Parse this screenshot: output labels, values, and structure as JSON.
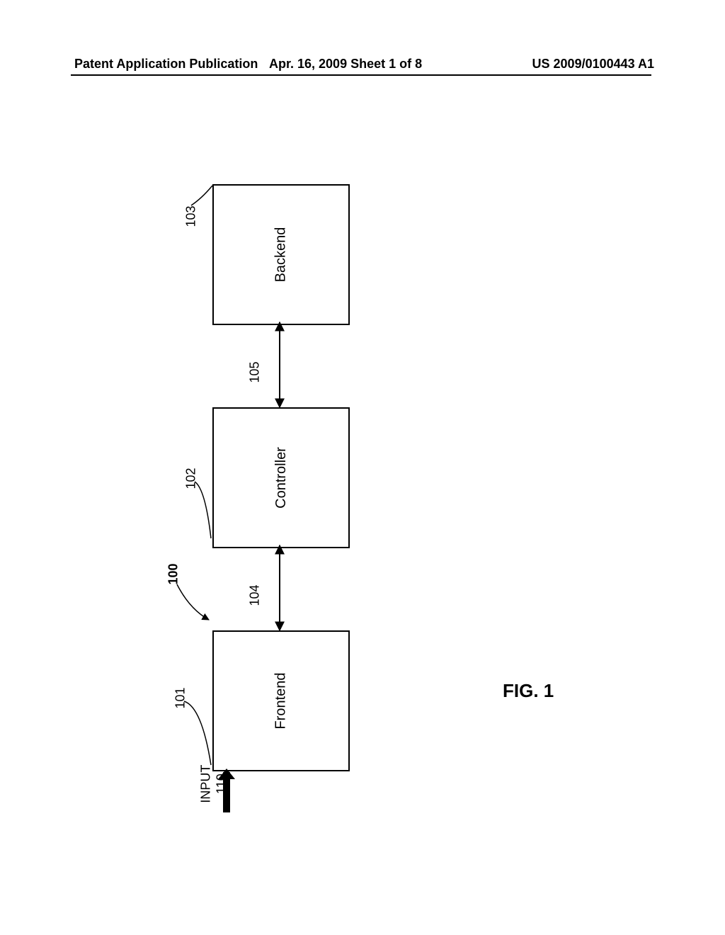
{
  "header": {
    "publication_type": "Patent Application Publication",
    "date_sheet": "Apr. 16, 2009  Sheet 1 of 8",
    "pub_number": "US 2009/0100443 A1"
  },
  "diagram": {
    "system_ref": "100",
    "input_label": "INPUT",
    "input_ref": "110",
    "blocks": {
      "frontend": {
        "label": "Frontend",
        "ref": "101"
      },
      "controller": {
        "label": "Controller",
        "ref": "102"
      },
      "backend": {
        "label": "Backend",
        "ref": "103"
      }
    },
    "connectors": {
      "frontend_controller": "104",
      "controller_backend": "105"
    }
  },
  "figure_label": "FIG. 1"
}
